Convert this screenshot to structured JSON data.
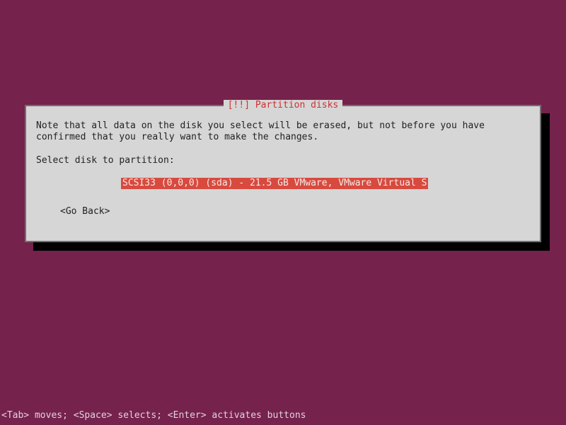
{
  "dialog": {
    "title_prefix": "[!!] ",
    "title": "Partition disks",
    "description": "Note that all data on the disk you select will be erased, but not before you have\nconfirmed that you really want to make the changes.",
    "prompt": "Select disk to partition:",
    "disks": [
      "SCSI33 (0,0,0) (sda) - 21.5 GB VMware, VMware Virtual S"
    ],
    "go_back": "<Go Back>"
  },
  "footer": {
    "help": "<Tab> moves; <Space> selects; <Enter> activates buttons"
  }
}
